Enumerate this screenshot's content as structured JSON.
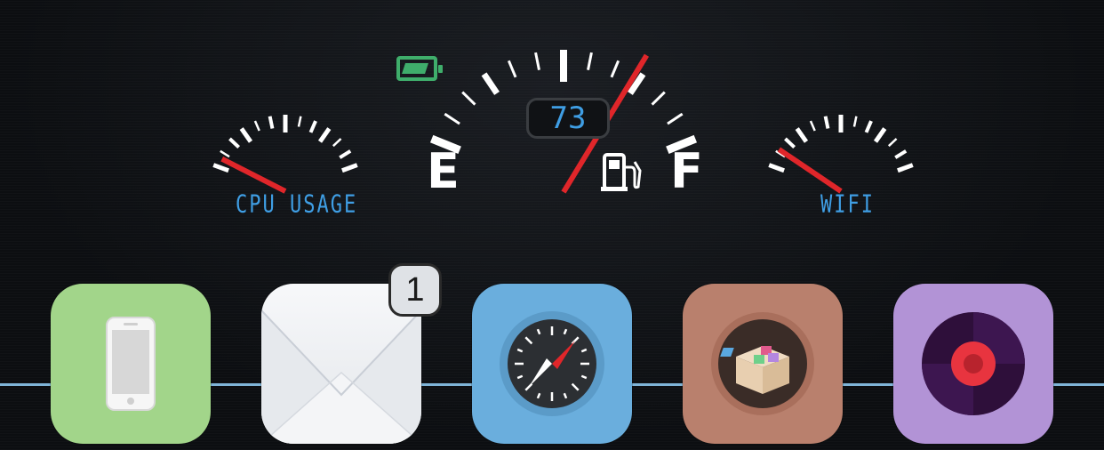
{
  "gauges": {
    "cpu": {
      "label": "CPU USAGE",
      "level": 0.05
    },
    "fuel": {
      "readout": "73",
      "empty_label": "E",
      "full_label": "F",
      "level": 0.73
    },
    "wifi": {
      "label": "WIFI",
      "level": 0.1
    }
  },
  "battery": {
    "icon": "battery-icon",
    "color": "#3fae6b"
  },
  "colors": {
    "accent": "#3f9ee4",
    "needle": "#e0262a",
    "tick": "#ffffff"
  },
  "dock": {
    "apps": [
      {
        "name": "Phone",
        "icon": "phone-icon",
        "color": "#a2d58a"
      },
      {
        "name": "Mail",
        "icon": "mail-icon",
        "color": "#eef0f3",
        "badge": "1"
      },
      {
        "name": "Safari",
        "icon": "compass-icon",
        "color": "#6aaedd"
      },
      {
        "name": "Cydia",
        "icon": "package-icon",
        "color": "#b9806d"
      },
      {
        "name": "Music",
        "icon": "record-icon",
        "color": "#b293d6"
      }
    ]
  }
}
